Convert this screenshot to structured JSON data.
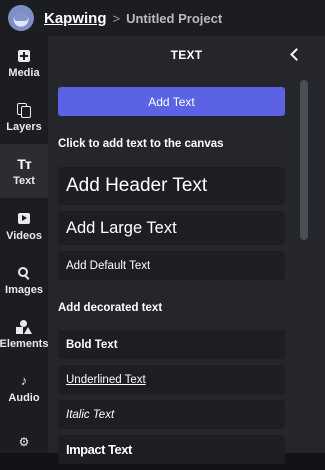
{
  "topbar": {
    "brand": "Kapwing",
    "separator": ">",
    "project_title": "Untitled Project"
  },
  "nav": {
    "items": [
      {
        "label": "Media",
        "icon": "media-icon"
      },
      {
        "label": "Layers",
        "icon": "layers-icon"
      },
      {
        "label": "Text",
        "icon": "text-icon",
        "active": true
      },
      {
        "label": "Videos",
        "icon": "videos-icon"
      },
      {
        "label": "Images",
        "icon": "search-icon"
      },
      {
        "label": "Elements",
        "icon": "shapes-icon"
      },
      {
        "label": "Audio",
        "icon": "music-note-icon"
      },
      {
        "label": "",
        "icon": "plugins-icon"
      }
    ]
  },
  "panel": {
    "title": "TEXT",
    "add_button": "Add Text",
    "click_hint": "Click to add text to the canvas",
    "basic_options": [
      "Add Header Text",
      "Add Large Text",
      "Add Default Text"
    ],
    "decorated_label": "Add decorated text",
    "decorated_options": [
      "Bold Text",
      "Underlined Text",
      "Italic Text",
      "Impact Text"
    ]
  },
  "colors": {
    "accent": "#5b63e4",
    "panel_bg": "#24262b",
    "sidebar_bg": "#1b1d21",
    "option_bg": "#1c1e22"
  }
}
